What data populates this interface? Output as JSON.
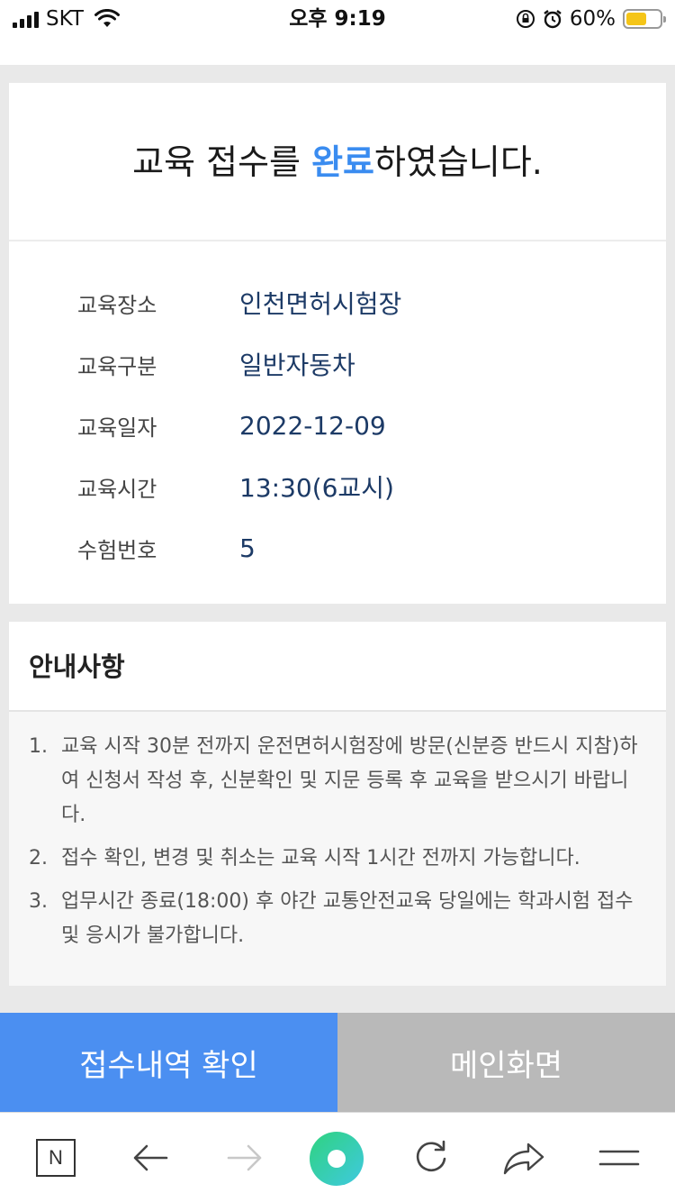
{
  "status_bar": {
    "carrier": "SKT",
    "time": "오후 9:19",
    "battery": "60%"
  },
  "complete": {
    "title_prefix": "교육 접수를 ",
    "title_highlight": "완료",
    "title_suffix": "하였습니다.",
    "rows": [
      {
        "label": "교육장소",
        "value": "인천면허시험장"
      },
      {
        "label": "교육구분",
        "value": "일반자동차"
      },
      {
        "label": "교육일자",
        "value": "2022-12-09"
      },
      {
        "label": "교육시간",
        "value": "13:30(6교시)"
      },
      {
        "label": "수험번호",
        "value": "5"
      }
    ]
  },
  "notice": {
    "title": "안내사항",
    "items": [
      {
        "num": "1.",
        "text": "교육 시작 30분 전까지 운전면허시험장에 방문(신분증 반드시 지참)하여 신청서 작성 후, 신분확인 및 지문 등록 후 교육을 받으시기 바랍니다."
      },
      {
        "num": "2.",
        "text": "접수 확인, 변경 및 취소는 교육 시작 1시간 전까지 가능합니다."
      },
      {
        "num": "3.",
        "text": "업무시간 종료(18:00) 후 야간 교통안전교육 당일에는 학과시험 접수 및 응시가 불가합니다."
      }
    ]
  },
  "buttons": {
    "primary": "접수내역 확인",
    "secondary": "메인화면"
  },
  "toolbar": {
    "naver_label": "N"
  },
  "colors": {
    "accent": "#3a8cf0",
    "primary_button": "#4b8ff1",
    "secondary_button": "#b9b9b9",
    "value_text": "#1c3a66"
  }
}
